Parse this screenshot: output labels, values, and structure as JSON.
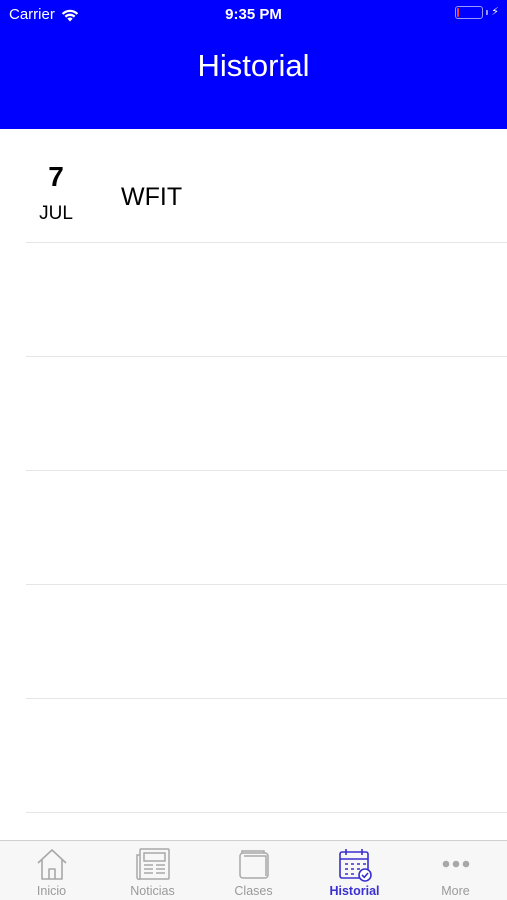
{
  "status_bar": {
    "carrier": "Carrier",
    "time": "9:35 PM",
    "battery_level_percent": 8,
    "battery_color": "#ff3b30"
  },
  "header": {
    "title": "Historial",
    "background": "#0000ff"
  },
  "history": [
    {
      "day": "7",
      "month": "JUL",
      "name": "WFIT"
    },
    {
      "day": "",
      "month": "",
      "name": ""
    },
    {
      "day": "",
      "month": "",
      "name": ""
    },
    {
      "day": "",
      "month": "",
      "name": ""
    },
    {
      "day": "",
      "month": "",
      "name": ""
    },
    {
      "day": "",
      "month": "",
      "name": ""
    }
  ],
  "tabbar": {
    "active_color": "#3a2fd0",
    "inactive_color": "#9a9a9a",
    "tabs": [
      {
        "label": "Inicio",
        "icon": "home-icon"
      },
      {
        "label": "Noticias",
        "icon": "newspaper-icon"
      },
      {
        "label": "Clases",
        "icon": "wallet-icon"
      },
      {
        "label": "Historial",
        "icon": "calendar-check-icon",
        "active": true
      },
      {
        "label": "More",
        "icon": "more-icon"
      }
    ]
  }
}
